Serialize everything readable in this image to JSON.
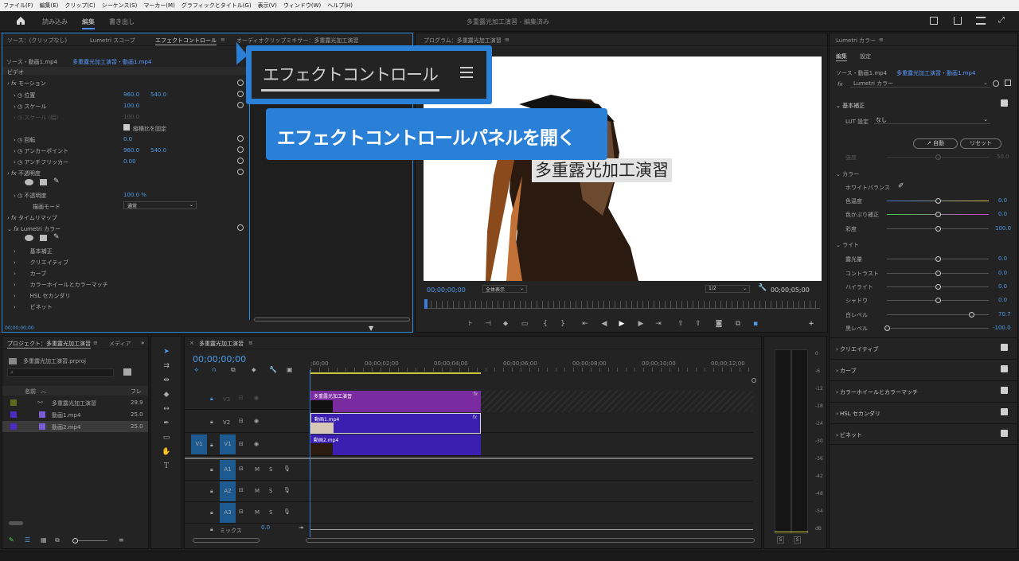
{
  "menu": [
    "ファイル(F)",
    "編集(E)",
    "クリップ(C)",
    "シーケンス(S)",
    "マーカー(M)",
    "グラフィックとタイトル(G)",
    "表示(V)",
    "ウィンドウ(W)",
    "ヘルプ(H)"
  ],
  "workspace": {
    "import": "読み込み",
    "edit": "編集",
    "export": "書き出し",
    "title": "多重露光加工演習 - 編集済み"
  },
  "source_panel": {
    "tabs": [
      "ソース：(クリップなし)",
      "Lumetri スコープ",
      "エフェクトコントロール",
      "オーディオクリップミキサー：多重露光加工演習"
    ],
    "master": "ソース・動画1.mp4",
    "seq": "多重露光加工演習・動画1.mp4",
    "section": "ビデオ",
    "timecode": "00;00;00;00",
    "rows": [
      {
        "label": "モーション"
      },
      {
        "label": "位置",
        "v1": "960.0",
        "v2": "540.0"
      },
      {
        "label": "スケール",
        "v1": "100.0"
      },
      {
        "label": "スケール (幅)",
        "v1": "100.0"
      },
      {
        "label": "縦横比を固定"
      },
      {
        "label": "回転",
        "v1": "0.0"
      },
      {
        "label": "アンカーポイント",
        "v1": "960.0",
        "v2": "540.0"
      },
      {
        "label": "アンチフリッカー",
        "v1": "0.00"
      },
      {
        "label": "不透明度"
      },
      {
        "label": "不透明度",
        "v1": "100.0 %"
      },
      {
        "label": "描画モード",
        "v1": "通常"
      },
      {
        "label": "タイムリマップ"
      },
      {
        "label": "Lumetri カラー"
      },
      {
        "label": "基本補正"
      },
      {
        "label": "クリエイティブ"
      },
      {
        "label": "カーブ"
      },
      {
        "label": "カラーホイールとカラーマッチ"
      },
      {
        "label": "HSL セカンダリ"
      },
      {
        "label": "ビネット"
      }
    ]
  },
  "callout": {
    "zoom_label": "エフェクトコントロール",
    "banner": "エフェクトコントロールパネルを開く"
  },
  "program": {
    "title": "プログラム：多重露光加工演習",
    "overlay_text": "多重露光加工演習",
    "tc_left": "00;00;00;00",
    "fit": "全体表示",
    "res": "1/2",
    "tc_right": "00;00;05;00"
  },
  "project": {
    "title": "プロジェクト：多重露光加工演習",
    "tab2": "メディア",
    "file": "多重露光加工演習.prproj",
    "col_name": "名前",
    "col_fps": "フレ",
    "items": [
      {
        "name": "多重露光加工演習",
        "fps": "29.9"
      },
      {
        "name": "動画1.mp4",
        "fps": "25.0"
      },
      {
        "name": "動画2.mp4",
        "fps": "25.0"
      }
    ]
  },
  "timeline": {
    "title": "多重露光加工演習",
    "tc": "00;00;00;00",
    "ticks": [
      ";00;00",
      "00;00;02;00",
      "00;00;04;00",
      "00;00;06;00",
      "00;00;08;00",
      "00;00;10;00",
      "00;00;12;00"
    ],
    "vtracks": [
      "V3",
      "V2",
      "V1"
    ],
    "atracks": [
      "A1",
      "A2",
      "A3"
    ],
    "mix": "ミックス",
    "mix_val": "0.0",
    "src_v": "V1",
    "clips": {
      "graphic": "多重露光加工演習",
      "v2": "動画1.mp4",
      "v1": "動画2.mp4"
    }
  },
  "meter": {
    "labels": [
      "0",
      "-6",
      "-12",
      "-18",
      "-24",
      "-30",
      "-36",
      "-42",
      "-48",
      "-54",
      "dB"
    ]
  },
  "lumetri": {
    "title": "Lumetri カラー",
    "tab_edit": "編集",
    "tab_settings": "設定",
    "master": "ソース・動画1.mp4",
    "seq": "多重露光加工演習・動画1.mp4",
    "fx": "Lumetri カラー",
    "basic": "基本補正",
    "lut_label": "LUT 設定",
    "lut_val": "なし",
    "auto": "自動",
    "reset": "リセット",
    "intensity": "強度",
    "intensity_val": "50.0",
    "color": "カラー",
    "wb": "ホワイトバランス",
    "color_rows": [
      {
        "label": "色温度",
        "val": "0.0"
      },
      {
        "label": "色かぶり補正",
        "val": "0.0"
      },
      {
        "label": "彩度",
        "val": "100.0"
      }
    ],
    "light": "ライト",
    "light_rows": [
      {
        "label": "露光量",
        "val": "0.0"
      },
      {
        "label": "コントラスト",
        "val": "0.0"
      },
      {
        "label": "ハイライト",
        "val": "0.0"
      },
      {
        "label": "シャドウ",
        "val": "0.0"
      },
      {
        "label": "白レベル",
        "val": "70.7"
      },
      {
        "label": "黒レベル",
        "val": "-100.0"
      }
    ],
    "sections": [
      "クリエイティブ",
      "カーブ",
      "カラーホイールとカラーマッチ",
      "HSL セカンダリ",
      "ビネット"
    ]
  }
}
